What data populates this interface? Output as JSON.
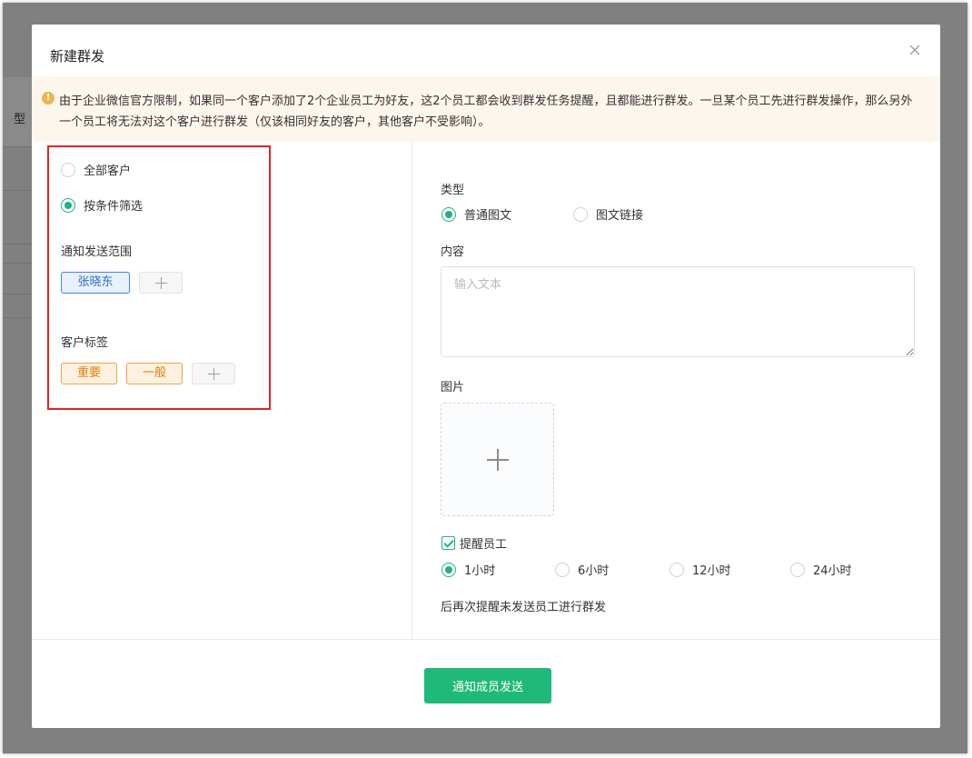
{
  "dialog": {
    "title": "新建群发",
    "notice": "由于企业微信官方限制，如果同一个客户添加了2个企业员工为好友，这2个员工都会收到群发任务提醒，且都能进行群发。一旦某个员工先进行群发操作，那么另外一个员工将无法对这个客户进行群发（仅该相同好友的客户，其他客户不受影响）。",
    "submit_label": "通知成员发送"
  },
  "background": {
    "cut_label": "型"
  },
  "left": {
    "scope_options": [
      {
        "label": "全部客户",
        "selected": false
      },
      {
        "label": "按条件筛选",
        "selected": true
      }
    ],
    "notify_range_label": "通知发送范围",
    "notify_members": [
      "张晓东"
    ],
    "customer_tags_label": "客户标签",
    "customer_tags": [
      "重要",
      "一般"
    ]
  },
  "right": {
    "type_label": "类型",
    "type_options": [
      {
        "label": "普通图文",
        "selected": true
      },
      {
        "label": "图文链接",
        "selected": false
      }
    ],
    "content_label": "内容",
    "content_placeholder": "输入文本",
    "content_value": "",
    "image_label": "图片",
    "remind_label": "提醒员工",
    "remind_checked": true,
    "remind_options": [
      {
        "label": "1小时",
        "selected": true
      },
      {
        "label": "6小时",
        "selected": false
      },
      {
        "label": "12小时",
        "selected": false
      },
      {
        "label": "24小时",
        "selected": false
      }
    ],
    "remind_hint": "后再次提醒未发送员工进行群发"
  },
  "colors": {
    "accent": "#1fb97a",
    "tag_blue": "#3d86e8",
    "tag_orange": "#f0a14d",
    "highlight_border": "#e02424",
    "notice_bg": "#fdf6ec"
  }
}
